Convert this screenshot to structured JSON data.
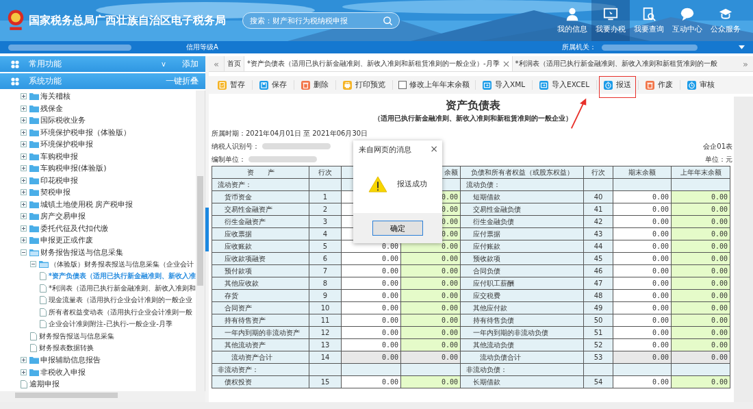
{
  "header": {
    "title": "国家税务总局广西壮族自治区电子税务局",
    "search": {
      "placeholder": "搜索：财产和行为税纳税申报"
    },
    "nav": [
      {
        "label": "我的信息",
        "kind": "profile",
        "selected": false
      },
      {
        "label": "我要办税",
        "kind": "desk",
        "selected": true
      },
      {
        "label": "我要查询",
        "kind": "query",
        "selected": false
      },
      {
        "label": "互动中心",
        "kind": "chat",
        "selected": false
      },
      {
        "label": "公众服务",
        "kind": "service",
        "selected": false
      }
    ]
  },
  "info_bar": {
    "credit": "信用等级A",
    "authority_label": "所属机关："
  },
  "sidebar": {
    "common": {
      "title": "常用功能",
      "caret": "v",
      "action": "添加"
    },
    "system": {
      "title": "系统功能",
      "action": "一键折叠"
    },
    "tree": [
      {
        "label": "海关稽核",
        "kind": "folder",
        "expanded": false
      },
      {
        "label": "残保金",
        "kind": "folder",
        "expanded": false
      },
      {
        "label": "国际税收业务",
        "kind": "folder",
        "expanded": false
      },
      {
        "label": "环境保护税申报（体验版）",
        "kind": "folder",
        "expanded": false
      },
      {
        "label": "环境保护税申报",
        "kind": "folder",
        "expanded": false
      },
      {
        "label": "车购税申报",
        "kind": "folder",
        "expanded": false
      },
      {
        "label": "车购税申报(体验版)",
        "kind": "folder",
        "expanded": false
      },
      {
        "label": "印花税申报",
        "kind": "folder",
        "expanded": false
      },
      {
        "label": "契税申报",
        "kind": "folder",
        "expanded": false
      },
      {
        "label": "城镇土地使用税 房产税申报",
        "kind": "folder",
        "expanded": false
      },
      {
        "label": "房产交易申报",
        "kind": "folder",
        "expanded": false
      },
      {
        "label": "委托代征及代扣代缴",
        "kind": "folder",
        "expanded": false
      },
      {
        "label": "申报更正或作废",
        "kind": "folder",
        "expanded": false
      },
      {
        "label": "财务报告报送与信息采集",
        "kind": "folder",
        "expanded": true,
        "children": [
          {
            "label": "（体验版）财务报表报送与信息采集（企业会计",
            "kind": "folder",
            "expanded": true,
            "children": [
              {
                "label": "*资产负债表（适用已执行新金融准则、新收入准",
                "kind": "doc",
                "selected": true
              },
              {
                "label": "*利润表（适用已执行新金融准则、新收入准则和",
                "kind": "doc",
                "selected": false
              },
              {
                "label": "现金流量表（适用执行企业会计准则的一般企业",
                "kind": "doc",
                "selected": false
              },
              {
                "label": "所有者权益变动表（适用执行企业会计准则一般",
                "kind": "doc",
                "selected": false
              },
              {
                "label": "企业会计准则附注-已执行-一般企业-月季",
                "kind": "doc",
                "selected": false
              }
            ]
          },
          {
            "label": "财务报告报送与信息采集",
            "kind": "doc",
            "selected": false
          },
          {
            "label": "财务报表数据转换",
            "kind": "doc",
            "selected": false
          }
        ]
      },
      {
        "label": "申报辅助信息报告",
        "kind": "folder",
        "expanded": false
      },
      {
        "label": "非税收入申报",
        "kind": "folder",
        "expanded": false
      },
      {
        "label": "逾期申报",
        "kind": "doc",
        "selected": false
      }
    ]
  },
  "tabs": {
    "prev": "«",
    "next": "»",
    "items": [
      {
        "label": "首页",
        "selected": false,
        "closable": false
      },
      {
        "label": "*资产负债表（适用已执行新金融准则、新收入准则和新租赁准则的一般企业）-月季",
        "selected": true,
        "closable": true
      },
      {
        "label": "*利润表（适用已执行新金融准则、新收入准则和新租赁准则的一般",
        "selected": false,
        "closable": false
      }
    ]
  },
  "toolbar": [
    {
      "label": "暂存",
      "kind": "button",
      "color": "#f5b324",
      "highlighted": false
    },
    {
      "label": "保存",
      "kind": "button",
      "color": "#1a9be8",
      "highlighted": false
    },
    {
      "label": "删除",
      "kind": "button",
      "color": "#f2764a",
      "highlighted": false
    },
    {
      "label": "打印预览",
      "kind": "button",
      "color": "#f5b324",
      "highlighted": false
    },
    {
      "label": "修改上年年末余额",
      "kind": "checkbox",
      "checked": false
    },
    {
      "label": "导入XML",
      "kind": "button",
      "color": "#1a9be8",
      "highlighted": false
    },
    {
      "label": "导入EXCEL",
      "kind": "button",
      "color": "#1a9be8",
      "highlighted": false
    },
    {
      "label": "报送",
      "kind": "button",
      "color": "#1a9be8",
      "highlighted": true
    },
    {
      "label": "作废",
      "kind": "button",
      "color": "#f2764a",
      "highlighted": false
    },
    {
      "label": "审核",
      "kind": "button",
      "color": "#1a9be8",
      "highlighted": false
    }
  ],
  "sheet": {
    "title": "资产负债表",
    "subtitle": "（适用已执行新金融准则、新收入准则和新租赁准则的一般企业）",
    "period": "所属时期：2021年04月01日 至 2021年06月30日",
    "taxpayer_label": "纳税人识别号：",
    "unit_label": "编制单位：",
    "form_no": "会企01表",
    "currency": "单位：元",
    "columns": [
      {
        "label": "资　　产"
      },
      {
        "label": "行次"
      },
      {},
      {
        "label": "余额"
      },
      {
        "label": "负债和所有者权益（或股东权益）"
      },
      {
        "label": "行次"
      },
      {
        "label": "期末余额"
      },
      {
        "label": "上年年末余额"
      }
    ],
    "rows": [
      {
        "kind": "section",
        "asset": "流动资产：",
        "liab": "流动负债："
      },
      {
        "kind": "item",
        "asset": "货币资金",
        "a_no": "1",
        "a_prev": "0.00",
        "liab": "短期借款",
        "l_no": "40",
        "l_end": "0.00",
        "l_prev": "0.00"
      },
      {
        "kind": "item",
        "asset": "交易性金融资产",
        "a_no": "2",
        "a_prev": "0.00",
        "liab": "交易性金融负债",
        "l_no": "41",
        "l_end": "0.00",
        "l_prev": "0.00"
      },
      {
        "kind": "item",
        "asset": "衍生金融资产",
        "a_no": "3",
        "a_prev": "0.00",
        "liab": "衍生金融负债",
        "l_no": "42",
        "l_end": "0.00",
        "l_prev": "0.00"
      },
      {
        "kind": "item",
        "asset": "应收票据",
        "a_no": "4",
        "a_prev": "0.00",
        "liab": "应付票据",
        "l_no": "43",
        "l_end": "0.00",
        "l_prev": "0.00"
      },
      {
        "kind": "item",
        "asset": "应收账款",
        "a_no": "5",
        "a_end": "0.00",
        "a_prev": "0.00",
        "liab": "应付账款",
        "l_no": "44",
        "l_end": "0.00",
        "l_prev": "0.00"
      },
      {
        "kind": "item",
        "asset": "应收款项融资",
        "a_no": "6",
        "a_end": "0.00",
        "a_prev": "0.00",
        "liab": "预收款项",
        "l_no": "45",
        "l_end": "0.00",
        "l_prev": "0.00"
      },
      {
        "kind": "item",
        "asset": "预付款项",
        "a_no": "7",
        "a_end": "0.00",
        "a_prev": "0.00",
        "liab": "合同负债",
        "l_no": "46",
        "l_end": "0.00",
        "l_prev": "0.00"
      },
      {
        "kind": "item",
        "asset": "其他应收款",
        "a_no": "8",
        "a_end": "0.00",
        "a_prev": "0.00",
        "liab": "应付职工薪酬",
        "l_no": "47",
        "l_end": "0.00",
        "l_prev": "0.00"
      },
      {
        "kind": "item",
        "asset": "存货",
        "a_no": "9",
        "a_end": "0.00",
        "a_prev": "0.00",
        "liab": "应交税费",
        "l_no": "48",
        "l_end": "0.00",
        "l_prev": "0.00"
      },
      {
        "kind": "item",
        "asset": "合同资产",
        "a_no": "10",
        "a_end": "0.00",
        "a_prev": "0.00",
        "liab": "其他应付款",
        "l_no": "49",
        "l_end": "0.00",
        "l_prev": "0.00"
      },
      {
        "kind": "item",
        "asset": "持有待售资产",
        "a_no": "11",
        "a_end": "0.00",
        "a_prev": "0.00",
        "liab": "持有待售负债",
        "l_no": "50",
        "l_end": "0.00",
        "l_prev": "0.00"
      },
      {
        "kind": "item",
        "asset": "一年内到期的非流动资产",
        "a_no": "12",
        "a_end": "0.00",
        "a_prev": "0.00",
        "liab": "一年内到期的非流动负债",
        "l_no": "51",
        "l_end": "0.00",
        "l_prev": "0.00"
      },
      {
        "kind": "item",
        "asset": "其他流动资产",
        "a_no": "13",
        "a_end": "0.00",
        "a_prev": "0.00",
        "liab": "其他流动负债",
        "l_no": "52",
        "l_end": "0.00",
        "l_prev": "0.00"
      },
      {
        "kind": "total",
        "asset": "流动资产合计",
        "a_no": "14",
        "a_end": "0.00",
        "a_prev": "0.00",
        "liab": "流动负债合计",
        "l_no": "53",
        "l_end": "0.00",
        "l_prev": "0.00"
      },
      {
        "kind": "section",
        "asset": "非流动资产：",
        "liab": "非流动负债："
      },
      {
        "kind": "item",
        "asset": "债权投资",
        "a_no": "15",
        "a_end": "0.00",
        "a_prev": "0.00",
        "liab": "长期借款",
        "l_no": "54",
        "l_end": "0.00",
        "l_prev": "0.00"
      }
    ]
  },
  "dialog": {
    "title": "来自网页的消息",
    "close": "×",
    "message": "报送成功",
    "button": "确定"
  }
}
